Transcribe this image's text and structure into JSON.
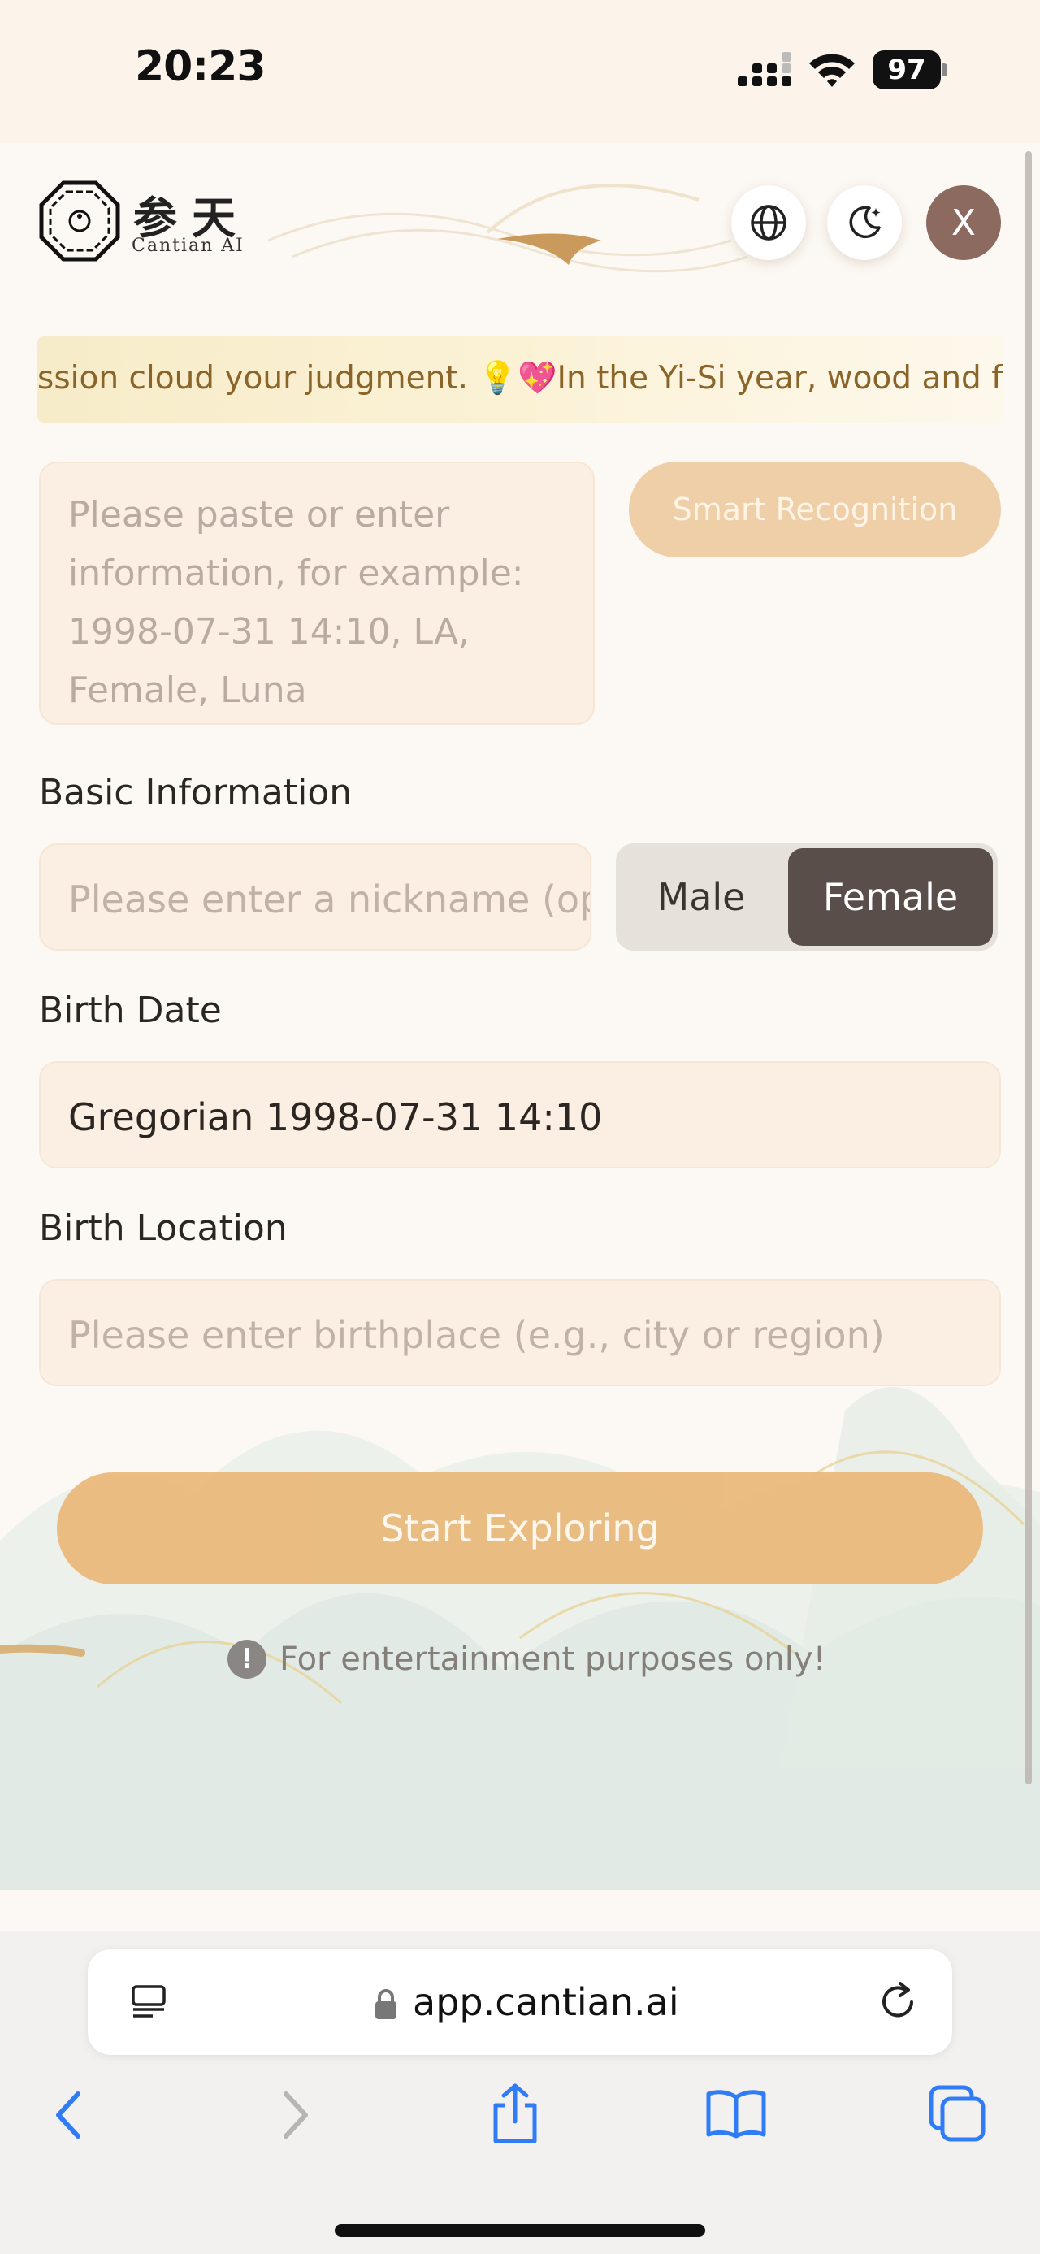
{
  "status_bar": {
    "time": "20:23",
    "battery": "97"
  },
  "header": {
    "logo_cn": "参天",
    "logo_en": "Cantian  AI",
    "avatar_letter": "X"
  },
  "marquee": {
    "text": "ssion cloud your judgment. 💡💖In the Yi-Si year, wood and fire thrive"
  },
  "form": {
    "paste_placeholder": "Please paste or enter information, for example: 1998-07-31 14:10, LA, Female, Luna",
    "smart_button": "Smart Recognition",
    "basic_info_label": "Basic Information",
    "nickname_placeholder": "Please enter a nickname (op",
    "gender_male": "Male",
    "gender_female": "Female",
    "gender_selected": "Female",
    "birth_date_label": "Birth Date",
    "birth_date_value": "Gregorian 1998-07-31 14:10",
    "birth_location_label": "Birth Location",
    "birth_location_placeholder": "Please enter birthplace (e.g., city or region)",
    "start_button": "Start Exploring",
    "disclaimer": "For entertainment purposes only!"
  },
  "browser": {
    "url": "app.cantian.ai"
  },
  "icons": {
    "language": "globe-icon",
    "theme": "moon-icon",
    "disclaimer": "exclamation-icon",
    "reader": "reader-icon",
    "lock": "lock-icon",
    "reload": "reload-icon",
    "back": "chevron-left-icon",
    "forward": "chevron-right-icon",
    "share": "share-icon",
    "bookmarks": "book-icon",
    "tabs": "tabs-icon"
  },
  "colors": {
    "accent": "#e9b87a",
    "selected_gender_bg": "#5a4e4b",
    "avatar_bg": "#8c6a5f",
    "safari_blue": "#2f7cf6"
  }
}
